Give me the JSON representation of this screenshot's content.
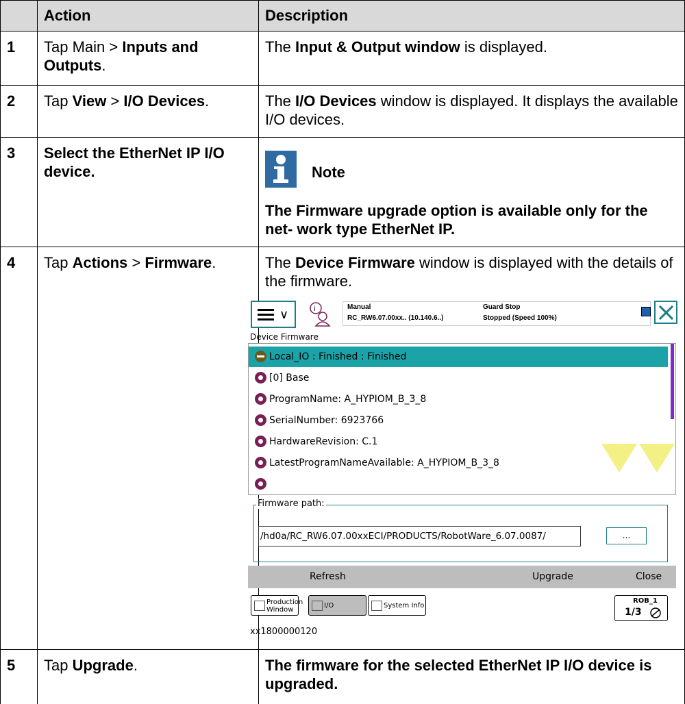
{
  "header": {
    "action": "Action",
    "description": "Description"
  },
  "rows": [
    {
      "num": "1",
      "action_pre": "Tap Main > ",
      "action_bold": "Inputs and Outputs",
      "action_post": ".",
      "desc_pre": "The ",
      "desc_bold": "Input & Output window",
      "desc_post": " is displayed."
    },
    {
      "num": "2",
      "action_pre": "Tap ",
      "action_bold": "View",
      "action_mid": " > ",
      "action_bold2": "I/O Devices",
      "action_post": ".",
      "desc_pre": "The ",
      "desc_bold": "I/O Devices",
      "desc_post": " window is displayed. It displays the available I/O devices."
    },
    {
      "num": "3",
      "action": "Select the EtherNet IP I/O device.",
      "note_title": "Note",
      "note_text": "The Firmware upgrade option is available only for the net- work type EtherNet IP."
    },
    {
      "num": "4",
      "action_pre": "Tap ",
      "action_bold": "Actions",
      "action_mid": " > ",
      "action_bold2": "Firmware",
      "action_post": ".",
      "desc_pre": "The ",
      "desc_bold": "Device Firmware",
      "desc_post": " window is displayed with the details of the firmware."
    },
    {
      "num": "5",
      "action_pre": "Tap ",
      "action_bold": "Upgrade",
      "action_post": ".",
      "desc": "The firmware for the selected EtherNet IP I/O device is upgraded."
    }
  ],
  "screenshot": {
    "status": {
      "mode": "Manual",
      "system": "RC_RW6.07.00xx.. (10.140.6..)",
      "guard": "Guard Stop",
      "state": "Stopped (Speed 100%)"
    },
    "window_title": "Device Firmware",
    "tree_items": [
      "Local_IO : Finished : Finished",
      "[0] Base",
      "ProgramName: A_HYPIOM_B_3_8",
      "SerialNumber: 6923766",
      "HardwareRevision: C.1",
      "LatestProgramNameAvailable: A_HYPIOM_B_3_8",
      ""
    ],
    "firmware_path_label": "Firmware path:",
    "firmware_path": "/hd0a/RC_RW6.07.00xxECI/PRODUCTS/RobotWare_6.07.0087/",
    "browse_label": "...",
    "commands": {
      "refresh": "Refresh",
      "upgrade": "Upgrade",
      "close": "Close"
    },
    "taskbar": {
      "production": "Production Window",
      "io": "I/O",
      "sysinfo": "System Info",
      "rob": "ROB_1",
      "fraction": "1/3"
    },
    "caption": "xx1800000120"
  },
  "colors": {
    "header_bg": "#d9d9d9",
    "note_blue": "#2f6aa3",
    "selected": "#1ba3a8",
    "bullet": "#7a1f56",
    "teal": "#1a7f86"
  }
}
